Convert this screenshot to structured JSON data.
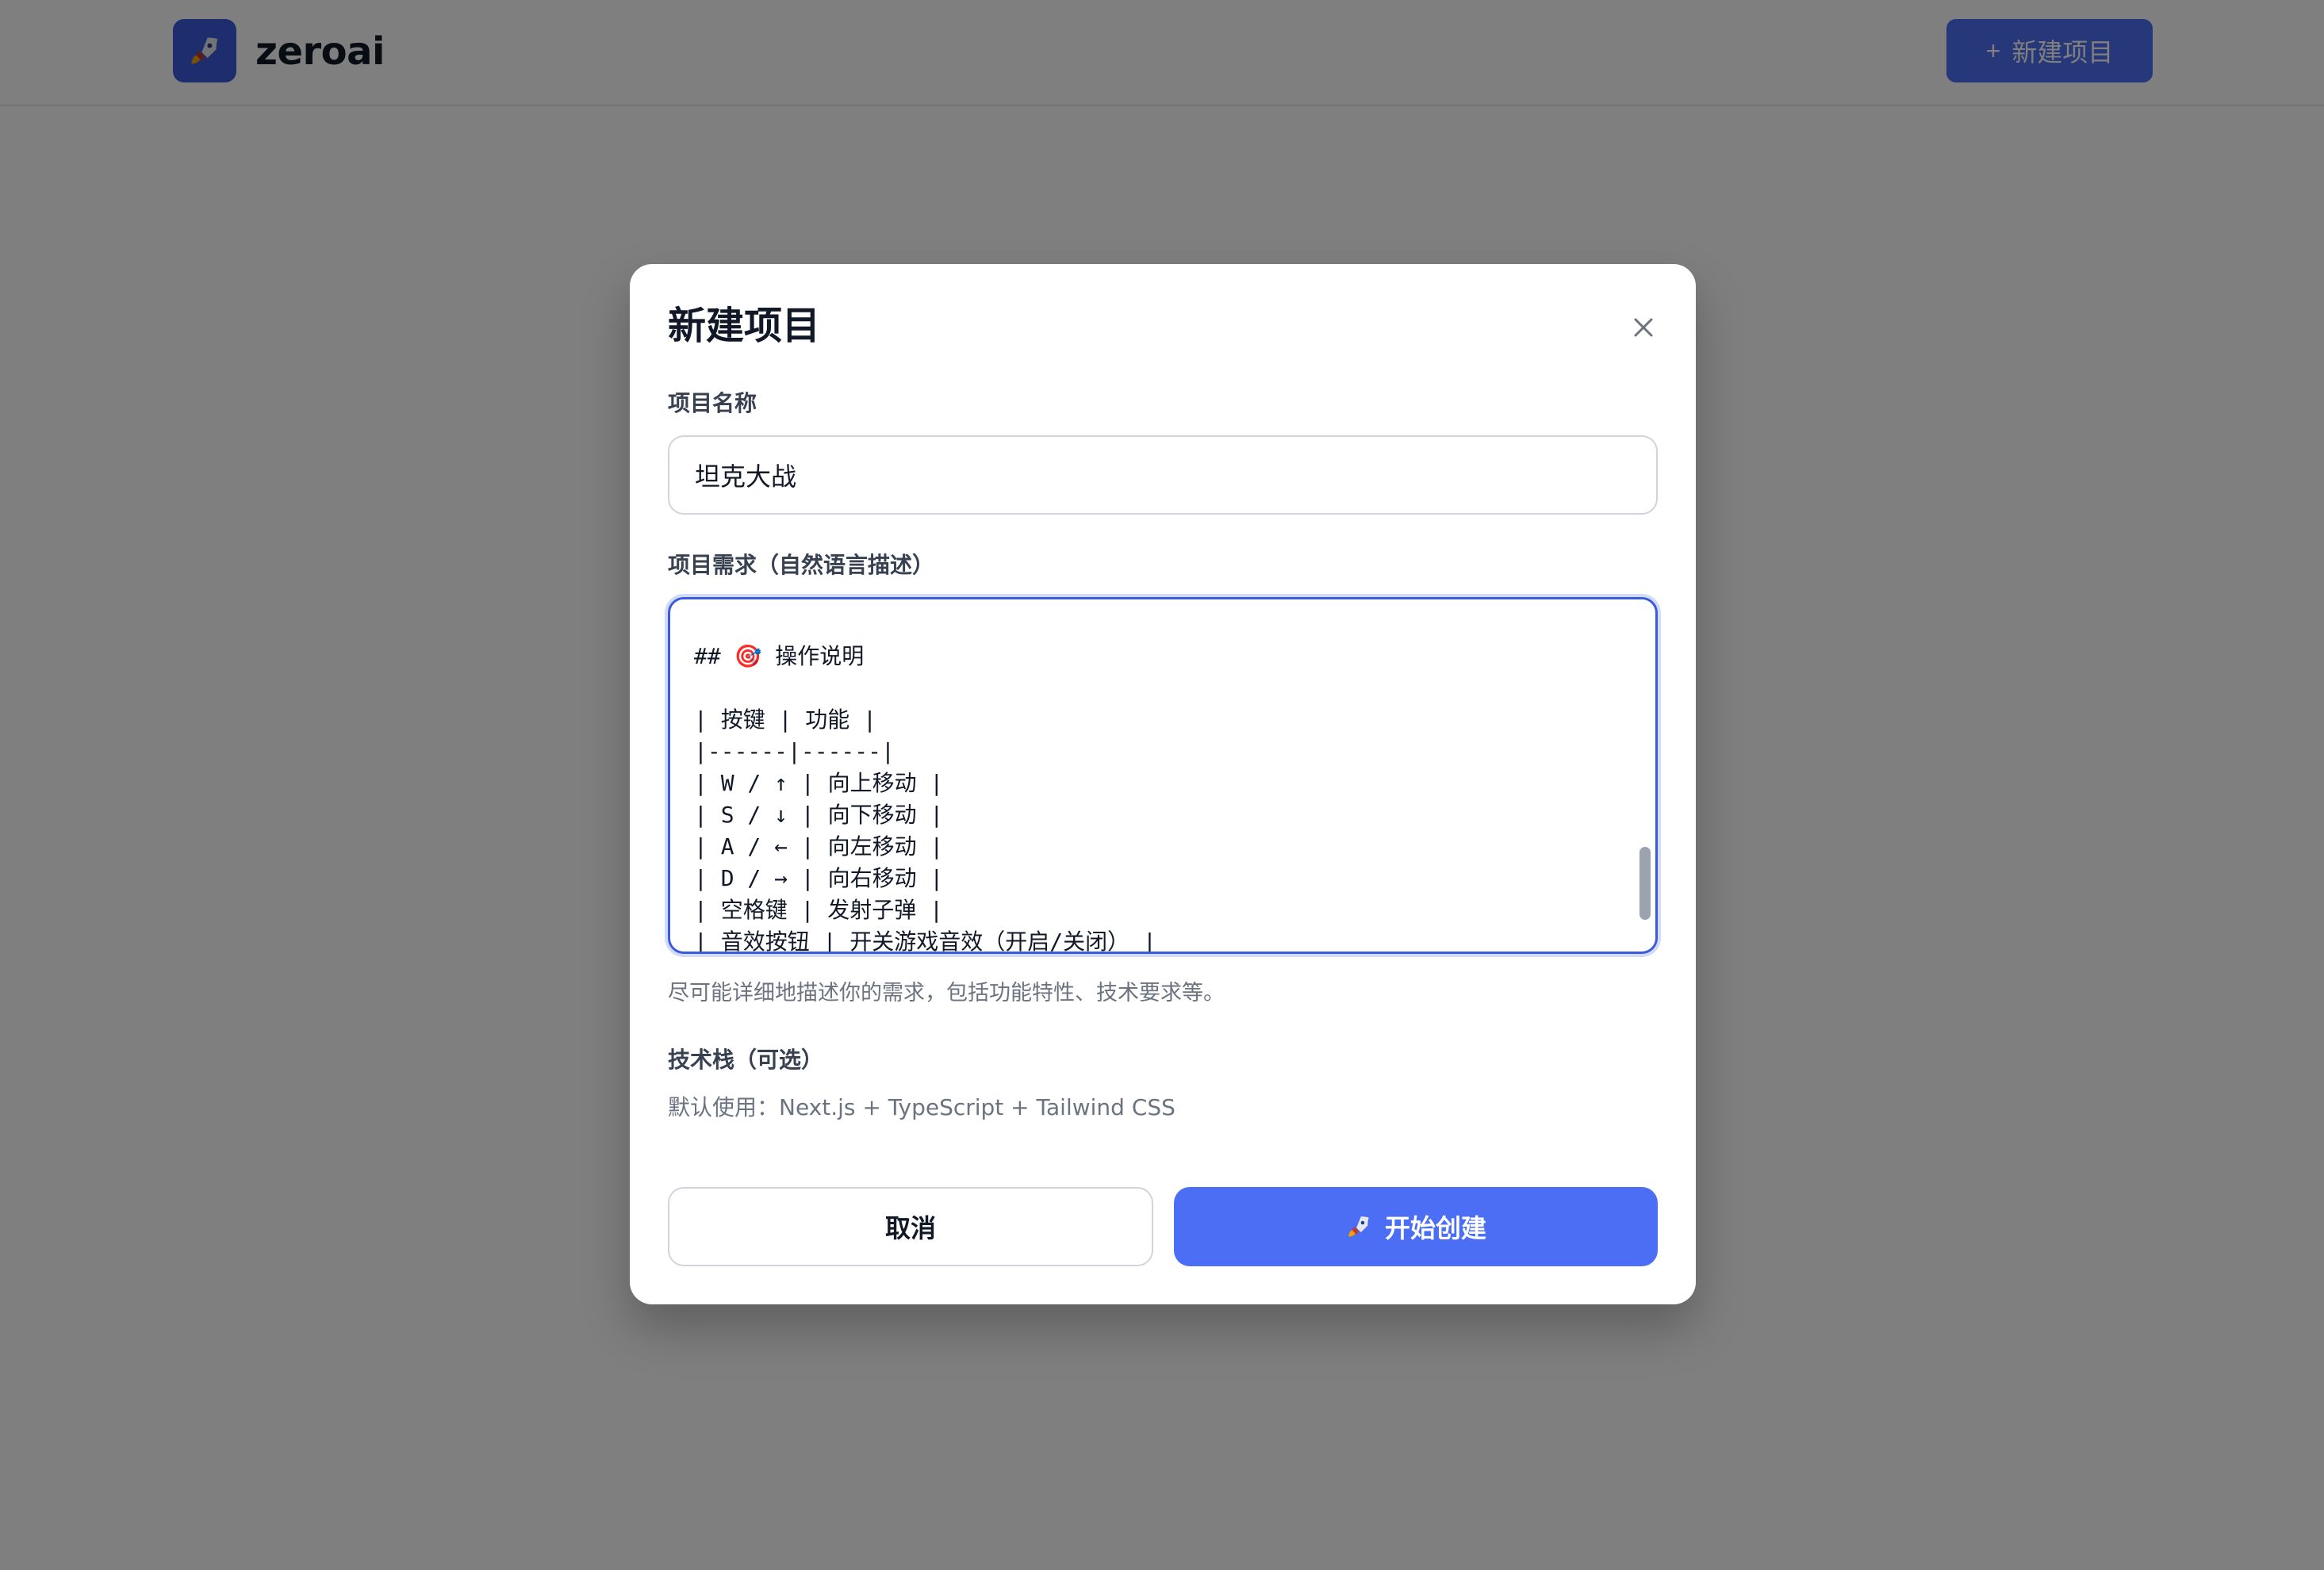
{
  "app": {
    "brand": "zeroai",
    "logo_icon": "rocket-icon",
    "new_project_label": "新建项目",
    "new_project_plus": "+"
  },
  "modal": {
    "title": "新建项目",
    "close_icon": "close-icon",
    "project_name": {
      "label": "项目名称",
      "value": "坦克大战"
    },
    "requirements": {
      "label": "项目需求（自然语言描述）",
      "value": "       \n\n## 🎯 操作说明\n\n| 按键 | 功能 |\n|------|------|\n| W / ↑ | 向上移动 |\n| S / ↓ | 向下移动 |\n| A / ← | 向左移动 |\n| D / → | 向右移动 |\n| 空格键 | 发射子弹 |\n| 音效按钮 | 开关游戏音效（开启/关闭） |",
      "hint": "尽可能详细地描述你的需求，包括功能特性、技术要求等。"
    },
    "tech_stack": {
      "label": "技术栈（可选）",
      "value": "默认使用：Next.js + TypeScript + Tailwind CSS"
    },
    "buttons": {
      "cancel": "取消",
      "create": "开始创建",
      "create_icon": "rocket-icon"
    }
  },
  "colors": {
    "accent": "#4c6ef5",
    "accent_dark": "#3b5bdb",
    "overlay": "rgba(0,0,0,0.5)"
  }
}
